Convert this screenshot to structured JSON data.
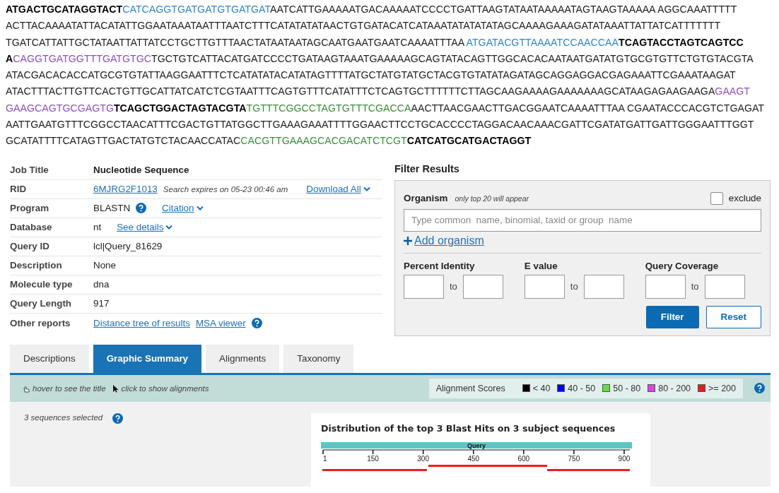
{
  "sequence": [
    [
      {
        "kind": "bold",
        "text": "ATGACTGCATAGGTACT"
      },
      {
        "kind": "blue",
        "text": "CATCAGGTGATGATGTGATGAT"
      },
      {
        "kind": "plain",
        "text": "AATCATTGAAAAATGACAAAAATCCCCTGATTAAGTATAATAAAAATAGTAAGTAAAAA AGGCAAATTTTT"
      }
    ],
    [
      {
        "kind": "plain",
        "text": "ACTTACAAAATATTACATATTGGAATAAATAATTTAATCTTTCATATATATAACTGTGATACATCATAAATATATATATAGCAAAAGAAAGATATAAATTATTATCATTTTTTT"
      }
    ],
    [
      {
        "kind": "plain",
        "text": "TGATCATTATTGCTATAATTATTATCCTGCTTGTTTAACTATAATAATAGCAATGAATGAATCAAAATTTAA "
      },
      {
        "kind": "blue",
        "text": "ATGATACGTTAAAATCCAACCAA"
      },
      {
        "kind": "bold",
        "text": "TCAGTACCTAGTCAGTCC"
      }
    ],
    [
      {
        "kind": "bold",
        "text": "A"
      },
      {
        "kind": "purple",
        "text": "CAGGTGATGGTTTGATGTGC"
      },
      {
        "kind": "plain",
        "text": "TGCTGTCATTACATGATCCCCTGATAAGTAAATGAAAAAGCAGTATACAGTTGGCACACAATAATGATATGTGCGTGTTCTGTGTACGTA"
      }
    ],
    [
      {
        "kind": "plain",
        "text": "ATACGACACACCATGCGTGTATTAAGGAATTTCTCATATATACATATAGTTTTATGCTATGTATGCTACGTGTATATAGATAGCAGGAGGACGAGAAATTCGAAATAAGAT"
      }
    ],
    [
      {
        "kind": "plain",
        "text": "ATACTTTACTTGTTCACTGTTGCATTATCATCTCGTAATTTCAGTGTTTCATATTTCTCAGTGCTTTTTTCTTAGCAAGAAAAGAAAAAAAGCATAAGAGAAGAAGA"
      },
      {
        "kind": "purple",
        "text": "GAAGT"
      }
    ],
    [
      {
        "kind": "purple",
        "text": "GAAGCAGTGCGAGTG"
      },
      {
        "kind": "bold",
        "text": "TCAGCTGGACTAGTACGTA"
      },
      {
        "kind": "green",
        "text": "TGTTTCGGCCTAGTGTTTCGACCA"
      },
      {
        "kind": "plain",
        "text": "AACTTAACGAACTTGACGGAATCAAAATTTAA CGAATACCCACGTCTGAGAT"
      }
    ],
    [
      {
        "kind": "plain",
        "text": "AATTGAATGTTTCGGCCTAACATTTCGACTGTTATGGCTTGAAAGAAATTTTGGAACTTCCTGCACCCCTAGGACAACAAACGATTCGATATGATTGATTGGGAATTTGGT"
      }
    ],
    [
      {
        "kind": "plain",
        "text": "GCATATTTTCATAGTTGACTATGTCTACAACCATAC"
      },
      {
        "kind": "green",
        "text": "CACGTTGAAAGCACGACATCTCGT"
      },
      {
        "kind": "bold",
        "text": "CATCATGCATGACTAGGT"
      }
    ]
  ],
  "job_info": [
    {
      "label": "Job Title",
      "parts": [
        {
          "kind": "bold",
          "text": "Nucleotide Sequence"
        }
      ]
    },
    {
      "label": "RID",
      "parts": [
        {
          "kind": "link",
          "text": "6MJRG2F1013"
        },
        {
          "kind": "note",
          "text": "Search expires on 05-23 00:46 am"
        },
        {
          "kind": "menu-link",
          "text": "Download All"
        }
      ]
    },
    {
      "label": "Program",
      "parts": [
        {
          "kind": "text",
          "text": "BLASTN"
        },
        {
          "kind": "help"
        },
        {
          "kind": "menu-link",
          "text": "Citation"
        }
      ]
    },
    {
      "label": "Database",
      "parts": [
        {
          "kind": "text",
          "text": "nt"
        },
        {
          "kind": "menu-link",
          "text": "See details"
        }
      ]
    },
    {
      "label": "Query ID",
      "parts": [
        {
          "kind": "text",
          "text": "lcl|Query_81629"
        }
      ]
    },
    {
      "label": "Description",
      "parts": [
        {
          "kind": "text",
          "text": "None"
        }
      ]
    },
    {
      "label": "Molecule type",
      "parts": [
        {
          "kind": "text",
          "text": "dna"
        }
      ]
    },
    {
      "label": "Query Length",
      "parts": [
        {
          "kind": "text",
          "text": "917"
        }
      ]
    },
    {
      "label": "Other reports",
      "parts": [
        {
          "kind": "link",
          "text": "Distance tree of results"
        },
        {
          "kind": "link",
          "text": "MSA viewer"
        },
        {
          "kind": "help"
        }
      ]
    }
  ],
  "filter": {
    "title": "Filter Results",
    "organism_label": "Organism",
    "organism_hint": "only top 20 will appear",
    "exclude": {
      "label": "exclude",
      "checked": false
    },
    "organism_placeholder": "Type common  name, binomial, taxid or group  name",
    "add_organism": "Add organism",
    "ranges": [
      {
        "label": "Percent Identity",
        "to": "to"
      },
      {
        "label": "E value",
        "to": "to"
      },
      {
        "label": "Query Coverage",
        "to": "to"
      }
    ],
    "buttons": [
      {
        "label": "Filter",
        "kind": "primary"
      },
      {
        "label": "Reset",
        "kind": "secondary"
      }
    ]
  },
  "tabs": [
    {
      "label": "Descriptions",
      "selected": false
    },
    {
      "label": "Graphic Summary",
      "selected": true
    },
    {
      "label": "Alignments",
      "selected": false
    },
    {
      "label": "Taxonomy",
      "selected": false
    }
  ],
  "toolbar": {
    "hints": [
      {
        "kind": "hand",
        "text": "hover to see the title"
      },
      {
        "kind": "pointer",
        "text": "click to show alignments"
      }
    ],
    "legend_title": "Alignment Scores",
    "legend": [
      {
        "label": "< 40",
        "color": "#000000"
      },
      {
        "label": "40 - 50",
        "color": "#0000ee"
      },
      {
        "label": "50 - 80",
        "color": "#66dd44"
      },
      {
        "label": "80 - 200",
        "color": "#dd44dd"
      },
      {
        "label": ">= 200",
        "color": "#e0201c"
      }
    ]
  },
  "selection_note": "3 sequences selected",
  "graphic": {
    "title": "Distribution of the top 3 Blast Hits on 3 subject sequences",
    "query_label": "Query",
    "ticks": [
      "1",
      "150",
      "300",
      "450",
      "600",
      "750",
      "900"
    ]
  }
}
